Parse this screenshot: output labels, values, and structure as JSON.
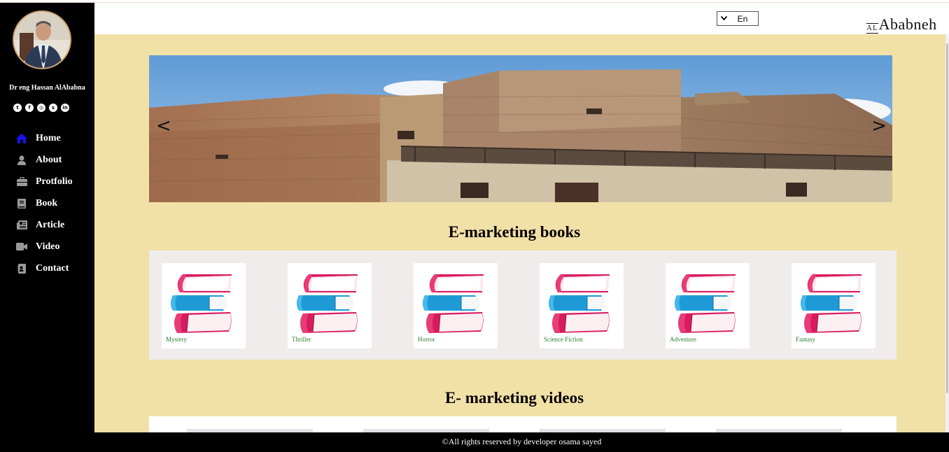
{
  "sidebar": {
    "author_name": "Dr eng Hassan AlAbabna",
    "socials": [
      {
        "icon": "twitter-icon",
        "glyph": "t"
      },
      {
        "icon": "facebook-icon",
        "glyph": "f"
      },
      {
        "icon": "instagram-icon",
        "glyph": "◎"
      },
      {
        "icon": "skype-icon",
        "glyph": "s"
      },
      {
        "icon": "linkedin-icon",
        "glyph": "in"
      }
    ],
    "nav": [
      {
        "label": "Home",
        "icon": "home-icon",
        "active": true
      },
      {
        "label": "About",
        "icon": "user-icon",
        "active": false
      },
      {
        "label": "Protfolio",
        "icon": "briefcase-icon",
        "active": false
      },
      {
        "label": "Book",
        "icon": "book-icon",
        "active": false
      },
      {
        "label": "Article",
        "icon": "newspaper-icon",
        "active": false
      },
      {
        "label": "Video",
        "icon": "video-icon",
        "active": false
      },
      {
        "label": "Contact",
        "icon": "contact-card-icon",
        "active": false
      }
    ]
  },
  "header": {
    "language": {
      "value": "En",
      "icon": "chevron-down-icon"
    },
    "logo": {
      "prefix": "AL",
      "name": "Ababneh"
    }
  },
  "slider": {
    "prev": "<",
    "next": ">"
  },
  "books_section": {
    "title": "E-marketing books",
    "items": [
      {
        "label": "Mystery"
      },
      {
        "label": "Thriller"
      },
      {
        "label": "Horror"
      },
      {
        "label": "Science Fiction"
      },
      {
        "label": "Adventure"
      },
      {
        "label": "Fantasy"
      }
    ]
  },
  "videos_section": {
    "title": "E- marketing videos"
  },
  "footer": {
    "text": "©All rights reserved by developer osama sayed"
  },
  "colors": {
    "sidebar_bg": "#000000",
    "main_bg": "#f2e1a7",
    "active_nav_icon": "#1a12e8",
    "book_label": "#2e7d32"
  }
}
